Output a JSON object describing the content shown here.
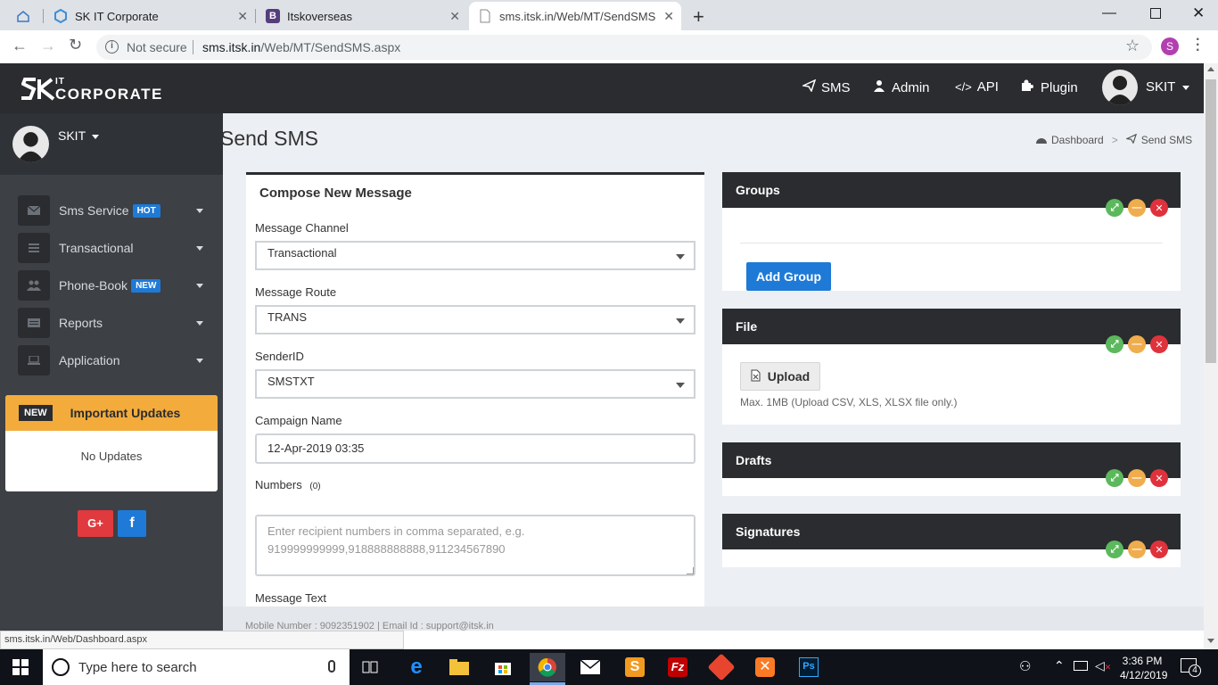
{
  "browser": {
    "tabs": [
      {
        "label": ""
      },
      {
        "label": "SK IT Corporate"
      },
      {
        "label": "Itskoverseas"
      },
      {
        "label": "sms.itsk.in/Web/MT/SendSMS.as"
      }
    ],
    "security": "Not secure",
    "url_domain": "sms.itsk.in",
    "url_path": "/Web/MT/SendSMS.aspx",
    "profile_initial": "S"
  },
  "header": {
    "logo_top": "IT",
    "logo_main": "CORPORATE",
    "nav": [
      {
        "label": "SMS"
      },
      {
        "label": "Admin"
      },
      {
        "label": "API"
      },
      {
        "label": "Plugin"
      }
    ],
    "user": "SKIT"
  },
  "sidebar": {
    "user": "SKIT",
    "items": [
      {
        "label": "Sms Service",
        "badge": "HOT"
      },
      {
        "label": "Transactional",
        "badge": ""
      },
      {
        "label": "Phone-Book",
        "badge": "NEW"
      },
      {
        "label": "Reports",
        "badge": ""
      },
      {
        "label": "Application",
        "badge": ""
      }
    ],
    "updates": {
      "badge": "NEW",
      "title": "Important Updates",
      "body": "No Updates"
    },
    "social": {
      "google": "G+",
      "facebook": "f"
    }
  },
  "page": {
    "title": "Send SMS",
    "breadcrumb": {
      "home": "Dashboard",
      "sep": ">",
      "current": "Send SMS"
    }
  },
  "compose": {
    "title": "Compose New Message",
    "channel_label": "Message Channel",
    "channel_value": "Transactional",
    "route_label": "Message Route",
    "route_value": "TRANS",
    "sender_label": "SenderID",
    "sender_value": "SMSTXT",
    "campaign_label": "Campaign Name",
    "campaign_value": "12-Apr-2019 03:35",
    "numbers_label": "Numbers",
    "numbers_count": "(0)",
    "numbers_placeholder": "Enter recipient numbers in comma separated, e.g. 919999999999,918888888888,911234567890",
    "message_label": "Message Text"
  },
  "groups": {
    "title": "Groups",
    "add_button": "Add Group"
  },
  "file": {
    "title": "File",
    "upload_button": "Upload",
    "hint": "Max. 1MB (Upload CSV, XLS, XLSX file only.)"
  },
  "drafts": {
    "title": "Drafts"
  },
  "signatures": {
    "title": "Signatures"
  },
  "footer": {
    "text": "Mobile Number : 9092351902 | Email Id : support@itsk.in"
  },
  "status_url": "sms.itsk.in/Web/Dashboard.aspx",
  "taskbar": {
    "search_placeholder": "Type here to search",
    "time": "3:36 PM",
    "date": "4/12/2019",
    "notifications": "4"
  },
  "colors": {
    "accent": "#1e7ad6",
    "dark": "#2a2c2f",
    "updates": "#f3ac3c",
    "google": "#e0393e",
    "facebook": "#1e7ad6"
  }
}
